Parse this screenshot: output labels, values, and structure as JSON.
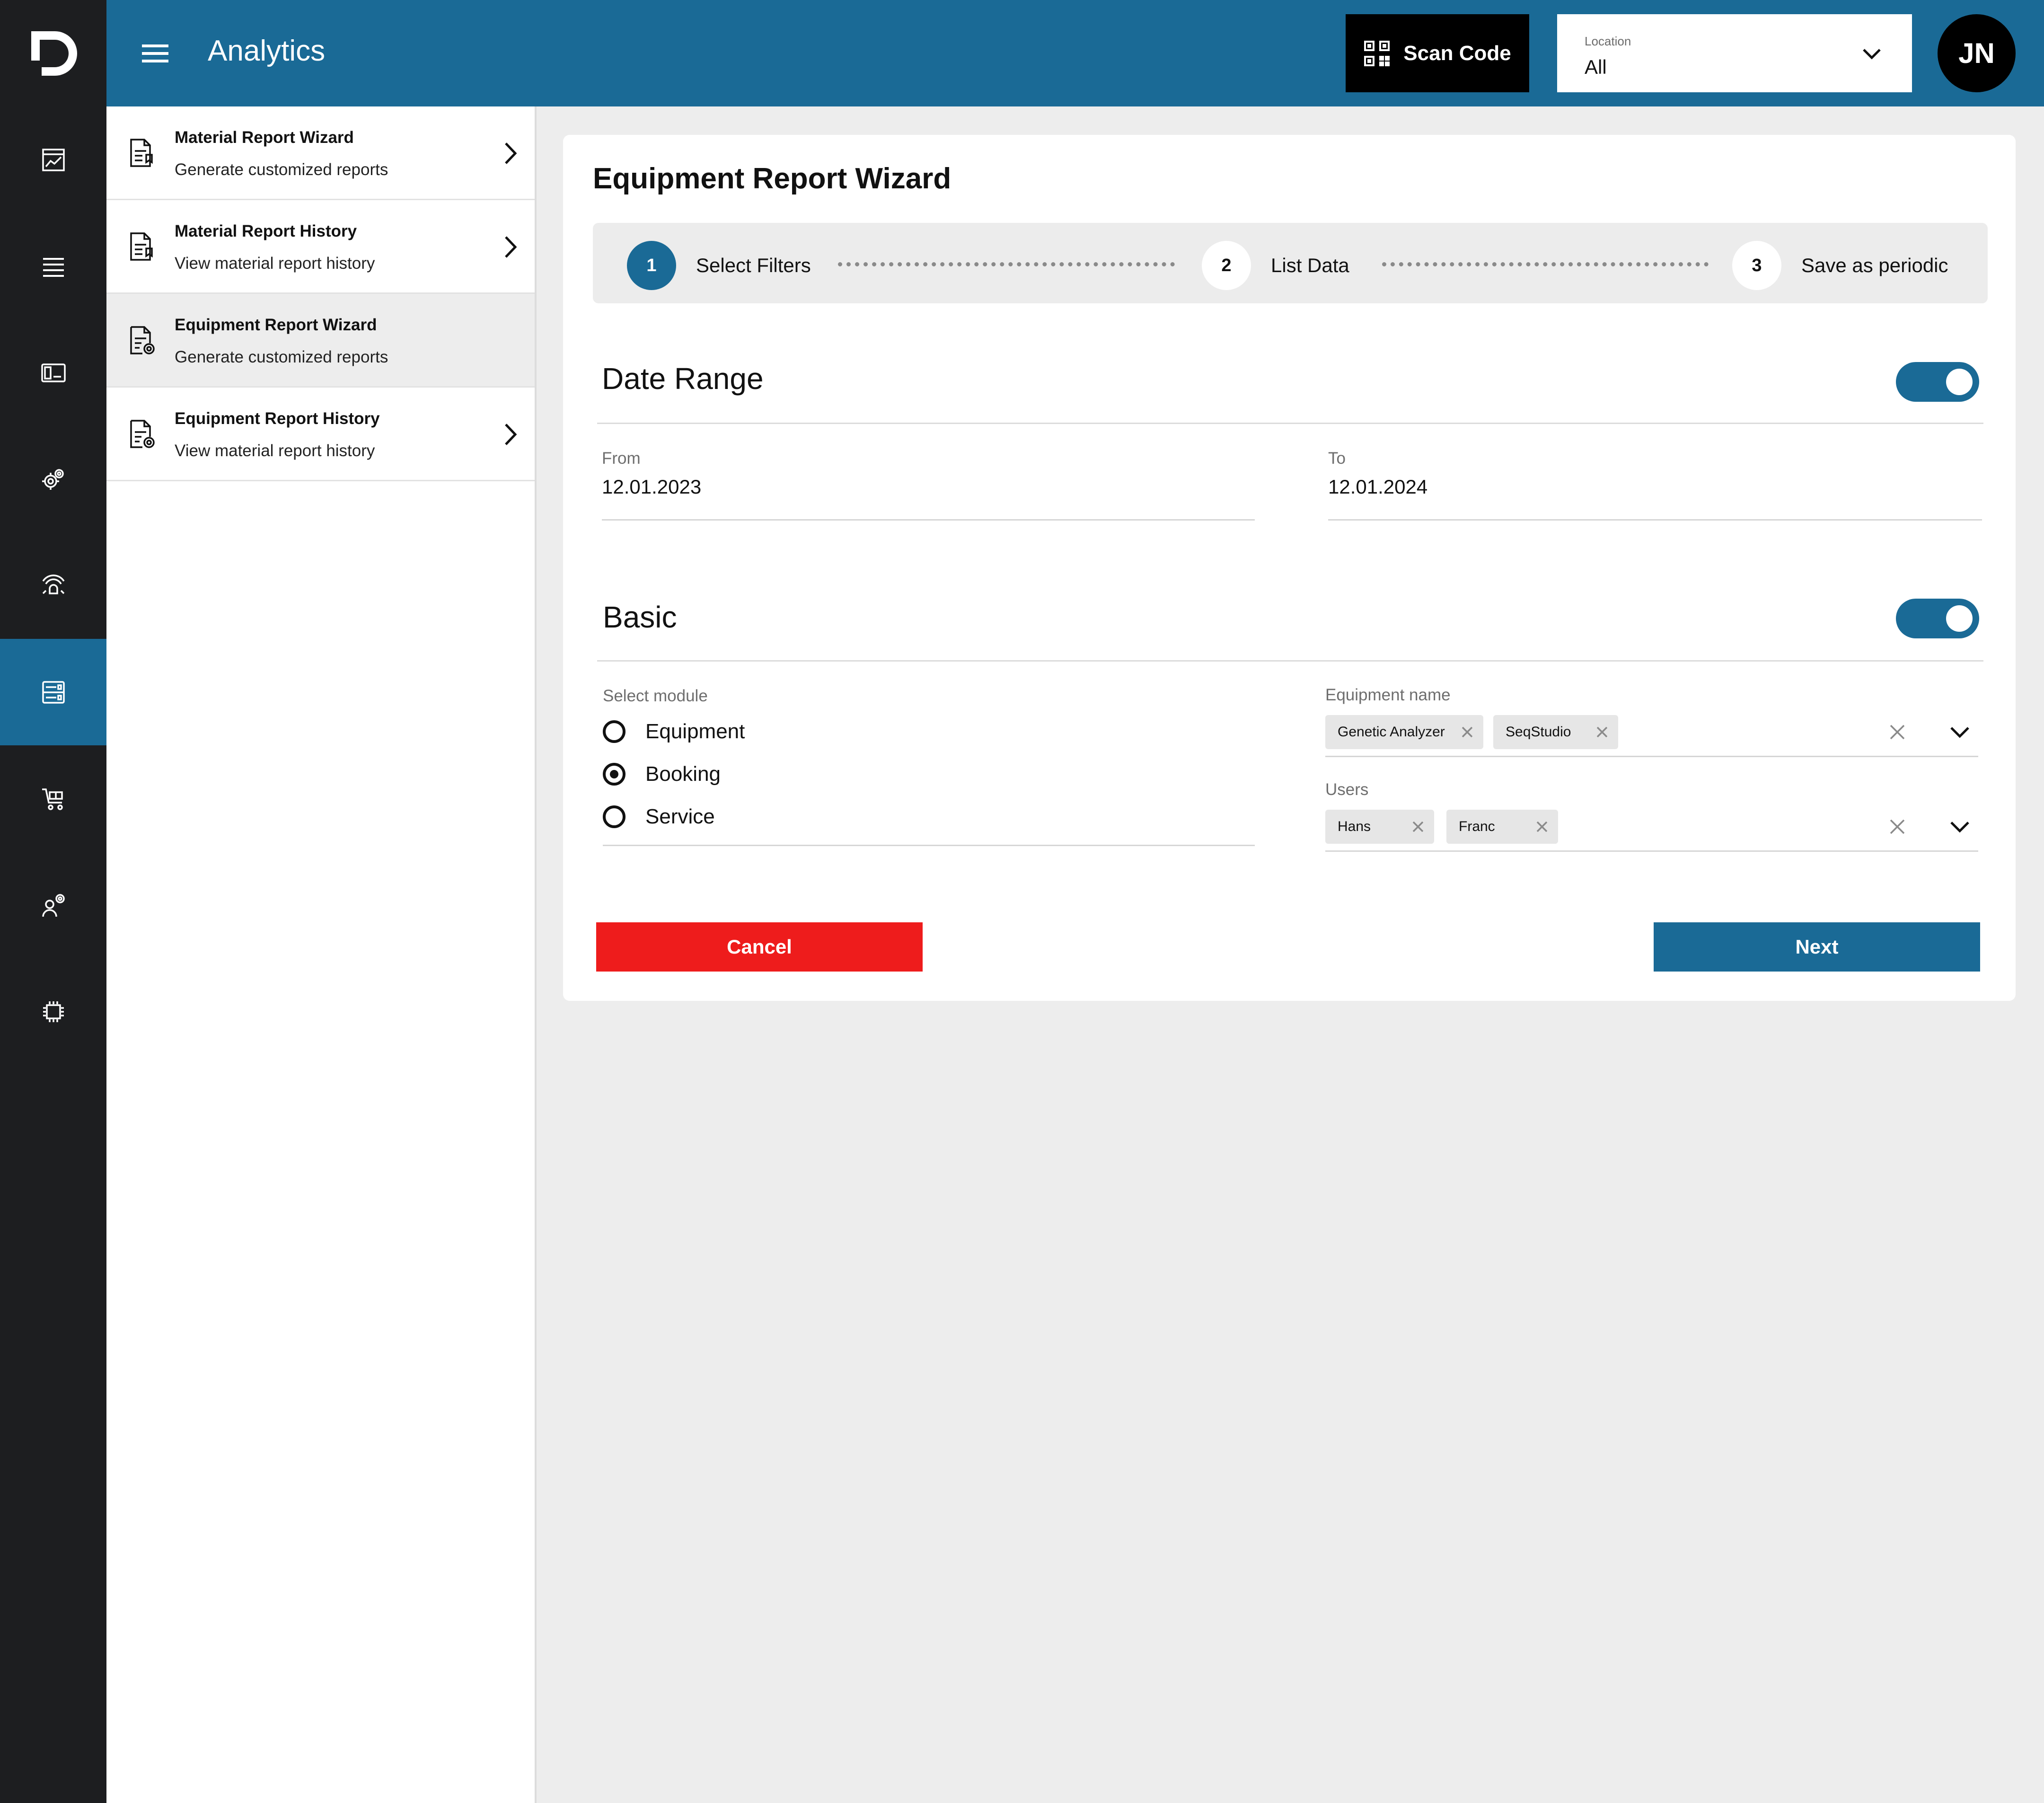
{
  "rail": {
    "logo": "dashboard-logo",
    "items": [
      {
        "icon": "chart-icon",
        "active": false
      },
      {
        "icon": "list-icon",
        "active": false
      },
      {
        "icon": "card-icon",
        "active": false
      },
      {
        "icon": "gears-icon",
        "active": false
      },
      {
        "icon": "sensor-icon",
        "active": false
      },
      {
        "icon": "analytics-icon",
        "active": true
      },
      {
        "icon": "cart-icon",
        "active": false
      },
      {
        "icon": "user-settings-icon",
        "active": false
      },
      {
        "icon": "chip-icon",
        "active": false
      }
    ]
  },
  "header": {
    "title": "Analytics",
    "scan_label": "Scan Code",
    "location_label": "Location",
    "location_value": "All",
    "avatar_initials": "JN"
  },
  "sidebar": {
    "items": [
      {
        "title": "Material Report Wizard",
        "desc": "Generate customized reports",
        "active": false,
        "chevron": true
      },
      {
        "title": "Material Report History",
        "desc": "View material report history",
        "active": false,
        "chevron": true
      },
      {
        "title": "Equipment Report Wizard",
        "desc": "Generate customized reports",
        "active": true,
        "chevron": false
      },
      {
        "title": "Equipment Report History",
        "desc": "View material report history",
        "active": false,
        "chevron": true
      }
    ]
  },
  "main": {
    "title": "Equipment Report Wizard",
    "steps": [
      {
        "num": "1",
        "label": "Select Filters",
        "active": true
      },
      {
        "num": "2",
        "label": "List Data",
        "active": false
      },
      {
        "num": "3",
        "label": "Save as periodic",
        "active": false
      }
    ],
    "date_range": {
      "title": "Date Range",
      "enabled": true,
      "from_label": "From",
      "from_value": "12.01.2023",
      "to_label": "To",
      "to_value": "12.01.2024"
    },
    "basic": {
      "title": "Basic",
      "enabled": true,
      "module_label": "Select module",
      "modules": [
        {
          "label": "Equipment",
          "checked": false
        },
        {
          "label": "Booking",
          "checked": true
        },
        {
          "label": "Service",
          "checked": false
        }
      ],
      "equipment_label": "Equipment name",
      "equipment_chips": [
        "Genetic Analyzer",
        "SeqStudio"
      ],
      "users_label": "Users",
      "user_chips": [
        "Hans",
        "Franc"
      ]
    },
    "cancel_label": "Cancel",
    "next_label": "Next"
  },
  "colors": {
    "primary": "#1a6a96",
    "rail_bg": "#1d1e20",
    "danger": "#ee1c1c",
    "page_bg": "#ededed"
  }
}
